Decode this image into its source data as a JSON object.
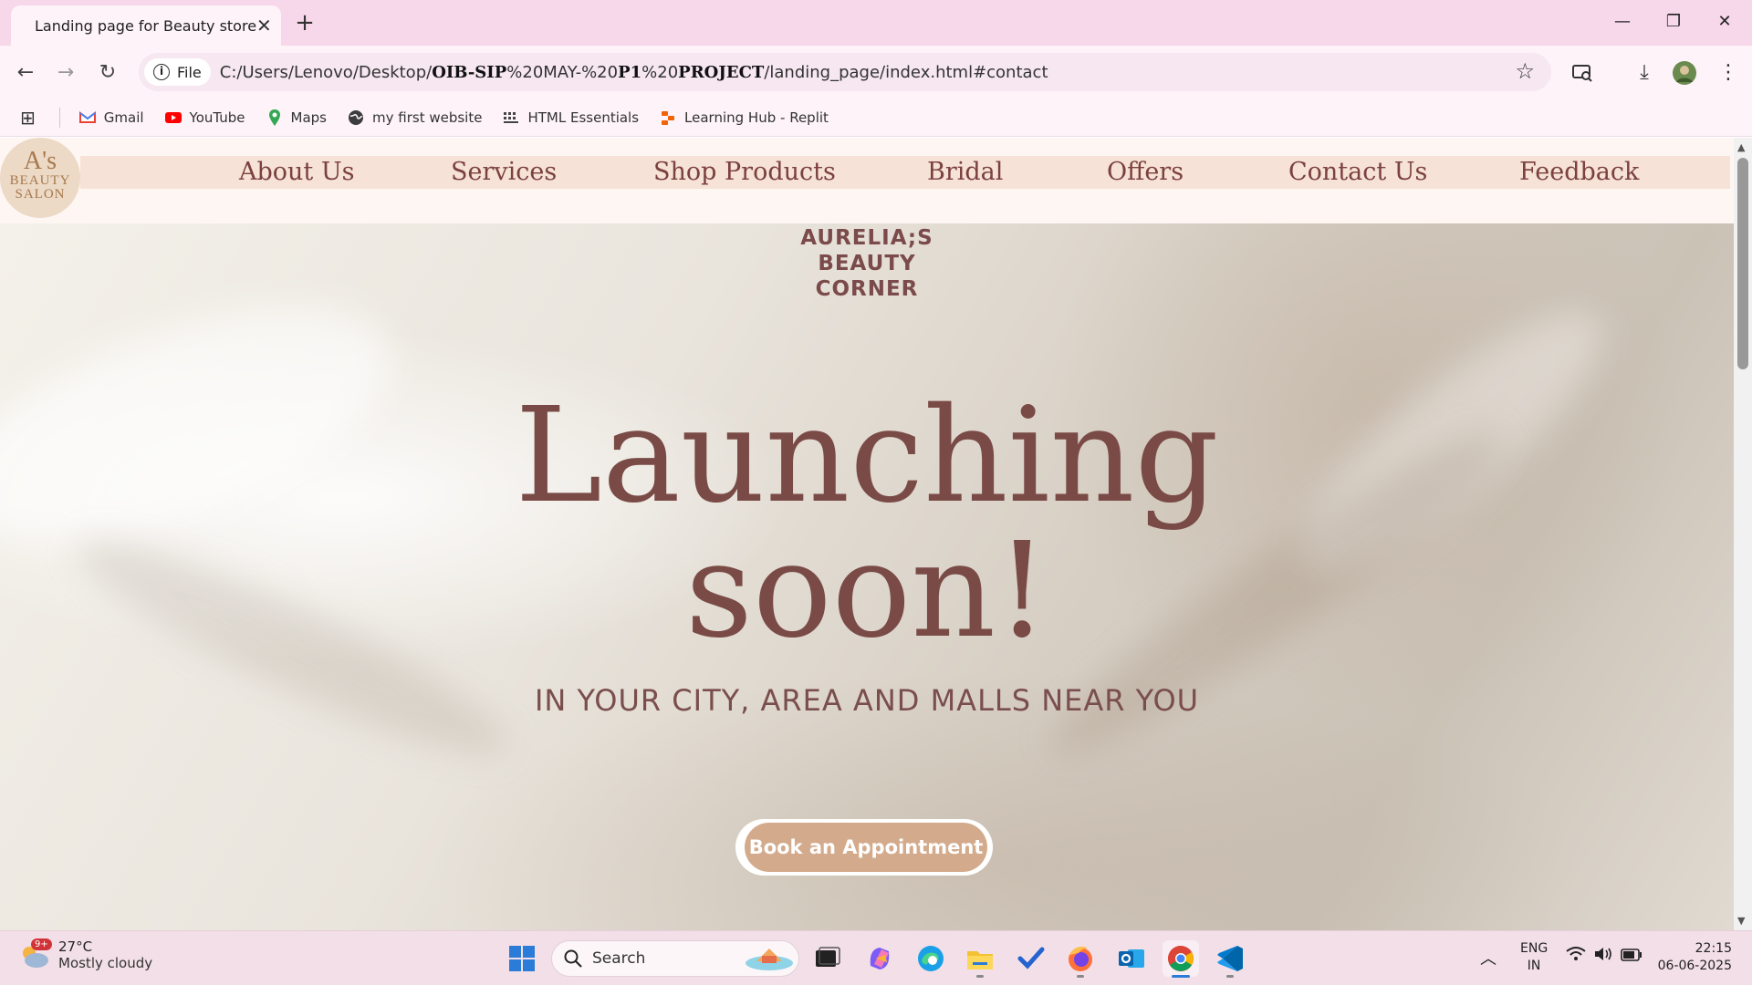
{
  "browser": {
    "tab_title": "Landing page for Beauty store",
    "url_scheme_label": "File",
    "url_parts": [
      "C:/Users/Lenovo/Desktop/",
      "OIB-SIP",
      "%20MAY-%20",
      "P1",
      "%20",
      "PROJECT",
      "/landing_page/index.html#contact"
    ],
    "bookmarks": [
      {
        "label": "Gmail",
        "icon": "gmail-icon"
      },
      {
        "label": "YouTube",
        "icon": "youtube-icon"
      },
      {
        "label": "Maps",
        "icon": "maps-icon"
      },
      {
        "label": "my first website",
        "icon": "globe-icon"
      },
      {
        "label": "HTML Essentials",
        "icon": "grid-dots-icon"
      },
      {
        "label": "Learning Hub - Replit",
        "icon": "replit-icon"
      }
    ]
  },
  "site": {
    "logo_line1": "A's",
    "logo_line2": "BEAUTY",
    "logo_line3": "SALON",
    "nav": [
      "About Us",
      "Services",
      "Shop Products",
      "Bridal",
      "Offers",
      "Contact Us",
      "Feedback"
    ],
    "brand_line1": "AURELIA;S",
    "brand_line2": "BEAUTY",
    "brand_line3": "CORNER",
    "headline_line1": "Launching",
    "headline_line2": "soon!",
    "subheading": "IN YOUR CITY, AREA AND MALLS NEAR YOU",
    "cta_label": "Book an Appointment",
    "accent_color": "#7b4040",
    "button_color": "#d3ab8c"
  },
  "taskbar": {
    "weather_badge": "9+",
    "temperature": "27°C",
    "weather_text": "Mostly cloudy",
    "search_label": "Search",
    "language_line1": "ENG",
    "language_line2": "IN",
    "time": "22:15",
    "date": "06-06-2025"
  }
}
